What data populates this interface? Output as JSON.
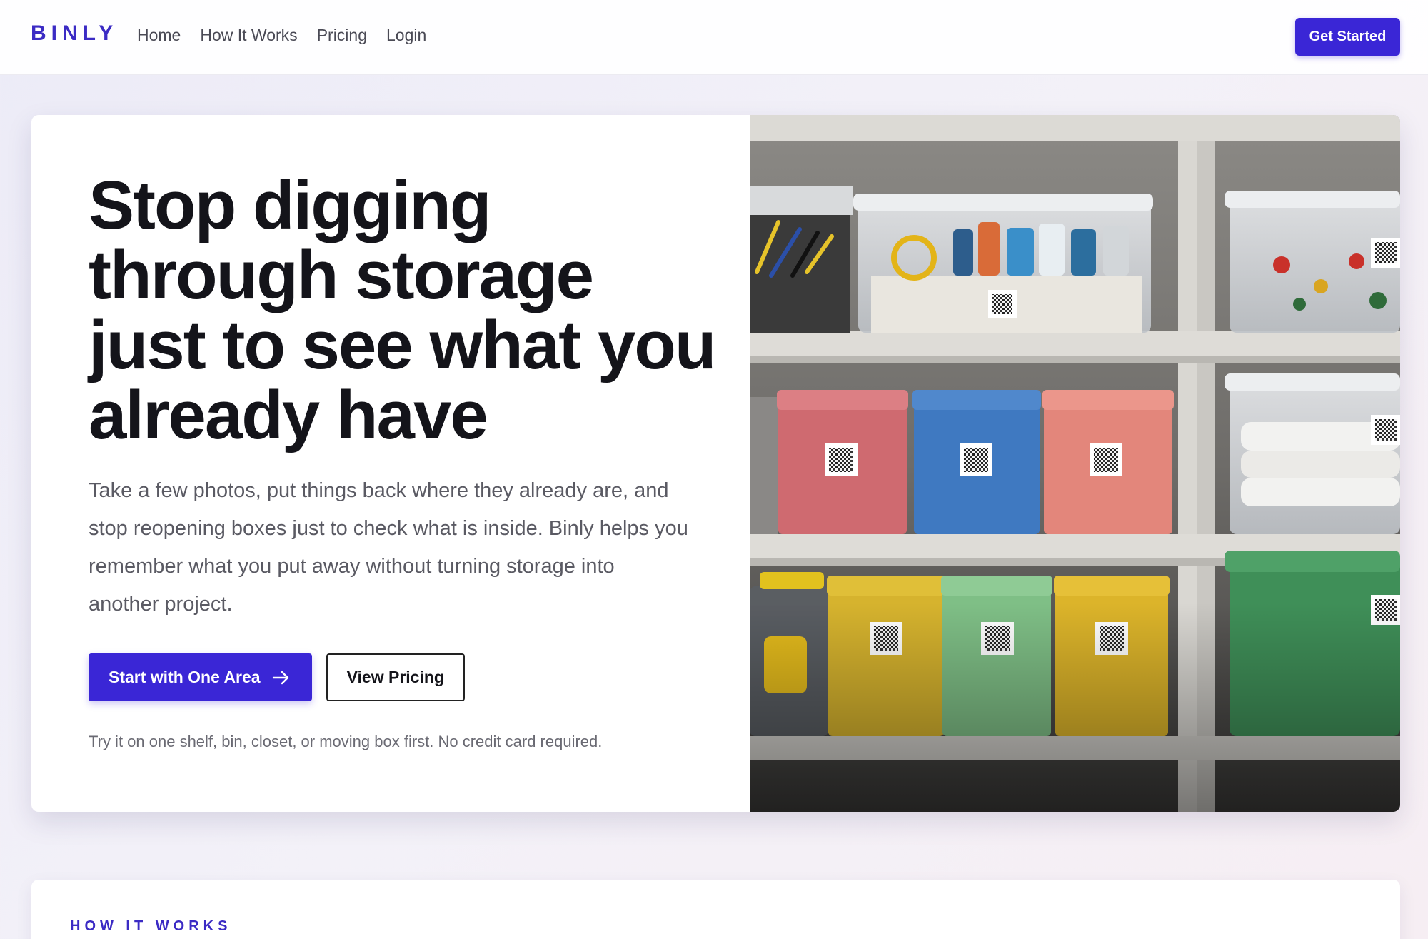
{
  "brand": {
    "name": "BINLY",
    "accent": "#3a26d6"
  },
  "nav": {
    "links": [
      "Home",
      "How It Works",
      "Pricing",
      "Login"
    ],
    "cta_label": "Get Started"
  },
  "hero": {
    "title": "Stop digging through storage just to see what you already have",
    "subtitle": "Take a few photos, put things back where they already are, and stop reopening boxes just to check what is inside. Binly helps you remember what you put away without turning storage into another project.",
    "primary_cta": "Start with One Area",
    "primary_cta_icon": "arrow-right-icon",
    "secondary_cta": "View Pricing",
    "note": "Try it on one shelf, bin, closet, or moving box first. No credit card required."
  },
  "how_it_works": {
    "eyebrow": "HOW IT WORKS"
  }
}
